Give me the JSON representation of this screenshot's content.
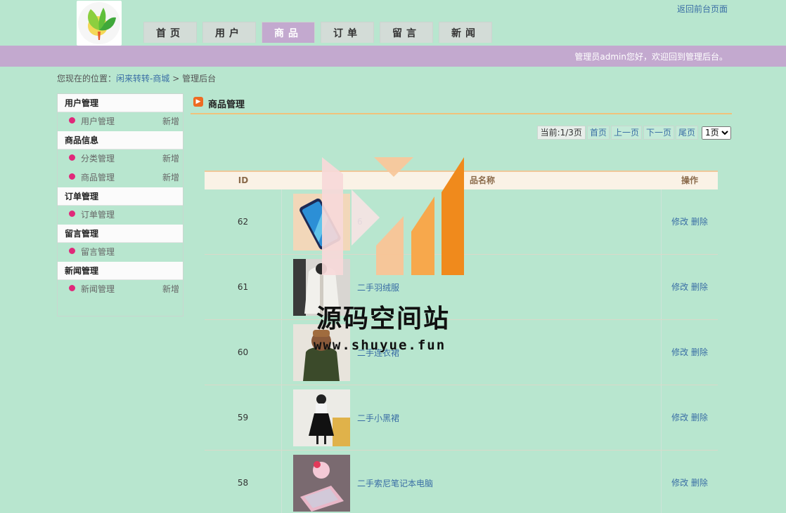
{
  "header": {
    "top_link": "返回前台页面",
    "welcome": "管理员admin您好，欢迎回到管理后台。",
    "nav": [
      {
        "label": "首页"
      },
      {
        "label": "用户"
      },
      {
        "label": "商品"
      },
      {
        "label": "订单"
      },
      {
        "label": "留言"
      },
      {
        "label": "新闻"
      }
    ],
    "active_nav": "商品"
  },
  "breadcrumb": {
    "prefix": "您现在的位置：",
    "site": "闲来转转-商城",
    "sep": ">",
    "current": "管理后台"
  },
  "sidebar": {
    "groups": [
      {
        "title": "用户管理",
        "items": [
          {
            "label": "用户管理",
            "add": "新增"
          }
        ]
      },
      {
        "title": "商品信息",
        "items": [
          {
            "label": "分类管理",
            "add": "新增"
          },
          {
            "label": "商品管理",
            "add": "新增"
          }
        ]
      },
      {
        "title": "订单管理",
        "items": [
          {
            "label": "订单管理",
            "add": ""
          }
        ]
      },
      {
        "title": "留言管理",
        "items": [
          {
            "label": "留言管理",
            "add": ""
          }
        ]
      },
      {
        "title": "新闻管理",
        "items": [
          {
            "label": "新闻管理",
            "add": "新增"
          }
        ]
      }
    ]
  },
  "panel": {
    "title": "商品管理",
    "pager": {
      "current": "当前:1/3页",
      "first": "首页",
      "prev": "上一页",
      "next": "下一页",
      "last": "尾页",
      "select_value": "1页"
    },
    "table": {
      "headers": {
        "id": "ID",
        "name": "品名称",
        "op": "操作"
      },
      "rows": [
        {
          "id": "62",
          "name": "6",
          "edit": "修改",
          "del": "删除",
          "thumb": "phone"
        },
        {
          "id": "61",
          "name": "二手羽绒服",
          "edit": "修改",
          "del": "删除",
          "thumb": "coat"
        },
        {
          "id": "60",
          "name": "二手连衣裙",
          "edit": "修改",
          "del": "删除",
          "thumb": "hood"
        },
        {
          "id": "59",
          "name": "二手小黑裙",
          "edit": "修改",
          "del": "删除",
          "thumb": "dress"
        },
        {
          "id": "58",
          "name": "二手索尼笔记本电脑",
          "edit": "修改",
          "del": "删除",
          "thumb": "laptop"
        }
      ]
    }
  },
  "watermark": {
    "text": "源码空间站",
    "url": "www.shuyue.fun"
  },
  "colors": {
    "background": "#b8e6cf",
    "accent_purple": "#c3a9cf",
    "link": "#3a6ea5",
    "bullet": "#e0287a",
    "orange": "#f08a1c"
  }
}
